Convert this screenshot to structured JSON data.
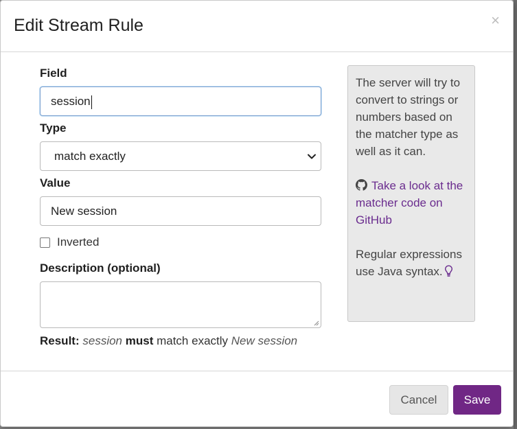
{
  "modal": {
    "title": "Edit Stream Rule",
    "close_label": "×"
  },
  "form": {
    "field": {
      "label": "Field",
      "value": "session"
    },
    "type": {
      "label": "Type",
      "selected": "match exactly"
    },
    "value": {
      "label": "Value",
      "value": "New session"
    },
    "inverted": {
      "label": "Inverted",
      "checked": false
    },
    "description": {
      "label": "Description (optional)",
      "value": ""
    }
  },
  "result": {
    "prefix": "Result:",
    "field": "session",
    "must": "must",
    "type": "match exactly",
    "value": "New session"
  },
  "help": {
    "p1": "The server will try to convert to strings or numbers based on the matcher type as well as it can.",
    "link": "Take a look at the matcher code on GitHub",
    "p3": "Regular expressions use Java syntax."
  },
  "footer": {
    "cancel_label": "Cancel",
    "save_label": "Save"
  },
  "colors": {
    "primary": "#702785",
    "link": "#6a2c8e",
    "help_bg": "#e9e9e9"
  },
  "icons": [
    "close-icon",
    "chevron-down-icon",
    "github-icon",
    "lightbulb-icon"
  ]
}
